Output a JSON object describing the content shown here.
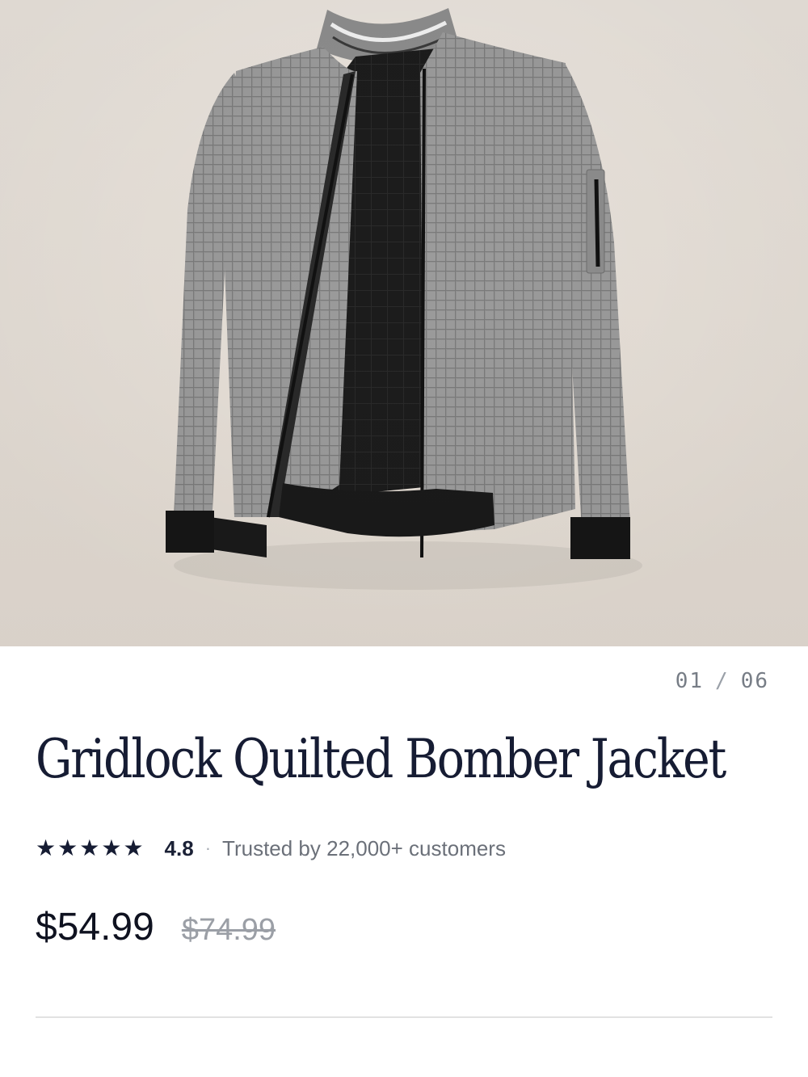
{
  "gallery": {
    "current": "01",
    "separator": "/",
    "total": "06",
    "image_icon": "bomber-jacket-photo"
  },
  "product": {
    "title": "Gridlock Quilted Bomber Jacket",
    "rating": {
      "stars": 5,
      "value": "4.8",
      "separator": "·",
      "trust_text": "Trusted by 22,000+ customers"
    },
    "price": "$54.99",
    "compare_at_price": "$74.99"
  },
  "colors": {
    "title": "#161c33",
    "background_photo": "#e7e0d8",
    "jacket": "#8f8f8f",
    "lining": "#1d1d1d"
  }
}
